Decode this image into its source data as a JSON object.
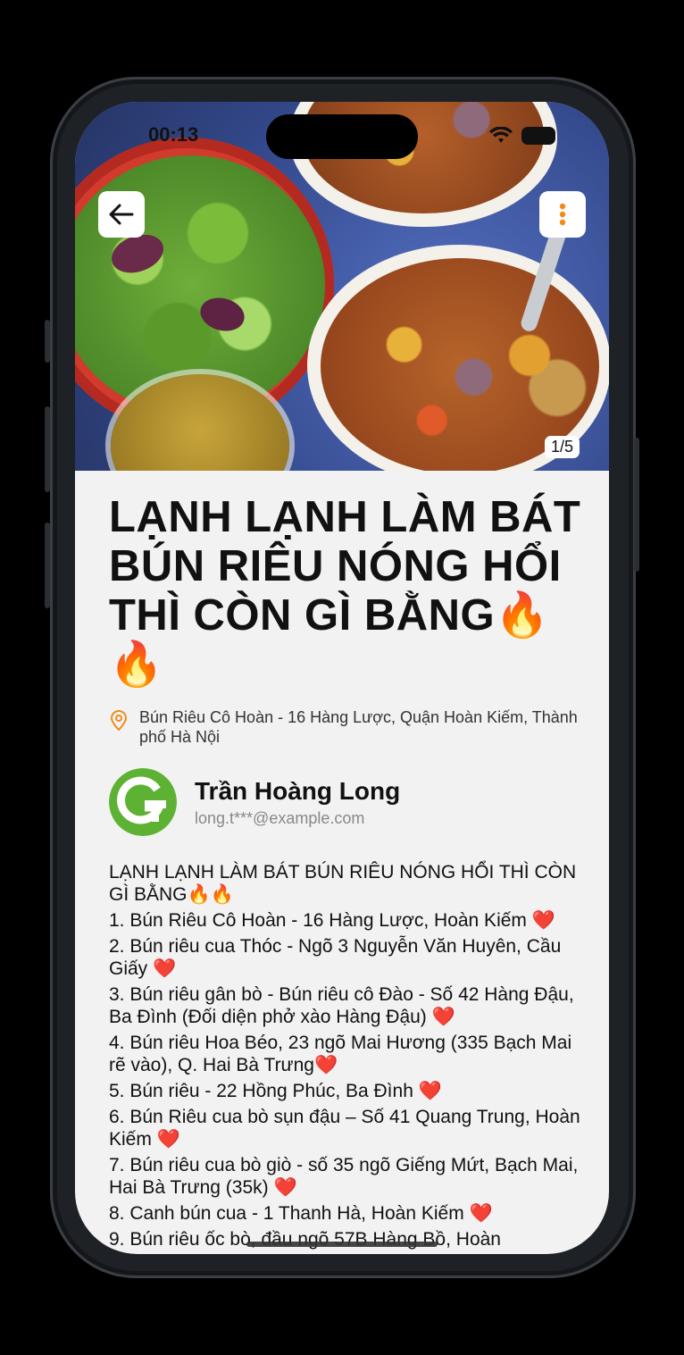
{
  "status_bar": {
    "time": "00:13"
  },
  "hero": {
    "pager": "1/5"
  },
  "post": {
    "title": "LẠNH LẠNH LÀM BÁT BÚN RIÊU NÓNG HỔI THÌ CÒN GÌ BẰNG🔥🔥",
    "location": "Bún Riêu Cô Hoàn - 16 Hàng Lược, Quận Hoàn Kiếm, Thành phố Hà Nội",
    "author": {
      "name": "Trần Hoàng Long",
      "email": "long.t***@example.com"
    },
    "description": [
      "LẠNH LẠNH LÀM BÁT BÚN RIÊU NÓNG HỔI THÌ CÒN GÌ BẰNG🔥🔥",
      "1. Bún Riêu Cô Hoàn - 16 Hàng Lược, Hoàn Kiếm ❤️",
      "2. Bún riêu cua Thóc - Ngõ 3 Nguyễn Văn Huyên, Cầu Giấy ❤️",
      "3. Bún riêu gân bò - Bún riêu cô Đào - Số 42 Hàng Đậu, Ba Đình (Đối diện phở xào Hàng Đậu) ❤️",
      "4. Bún riêu Hoa Béo, 23 ngõ Mai Hương (335 Bạch Mai rẽ vào), Q. Hai Bà Trưng❤️",
      "5. Bún riêu - 22 Hồng Phúc, Ba Đình ❤️",
      "6. Bún Riêu cua bò sụn đậu – Số 41 Quang Trung, Hoàn Kiếm ❤️",
      "7. Bún riêu cua bò giò - số 35 ngõ Giếng Mứt, Bạch Mai, Hai Bà Trưng (35k) ❤️",
      "8. Canh bún cua - 1 Thanh Hà, Hoàn Kiếm ❤️",
      "9. Bún riêu ốc bò, đầu ngõ 57B Hàng Bồ, Hoàn"
    ]
  },
  "colors": {
    "accent": "#f28a1a",
    "logo_green": "#5db233",
    "background": "#f2f2f2"
  }
}
